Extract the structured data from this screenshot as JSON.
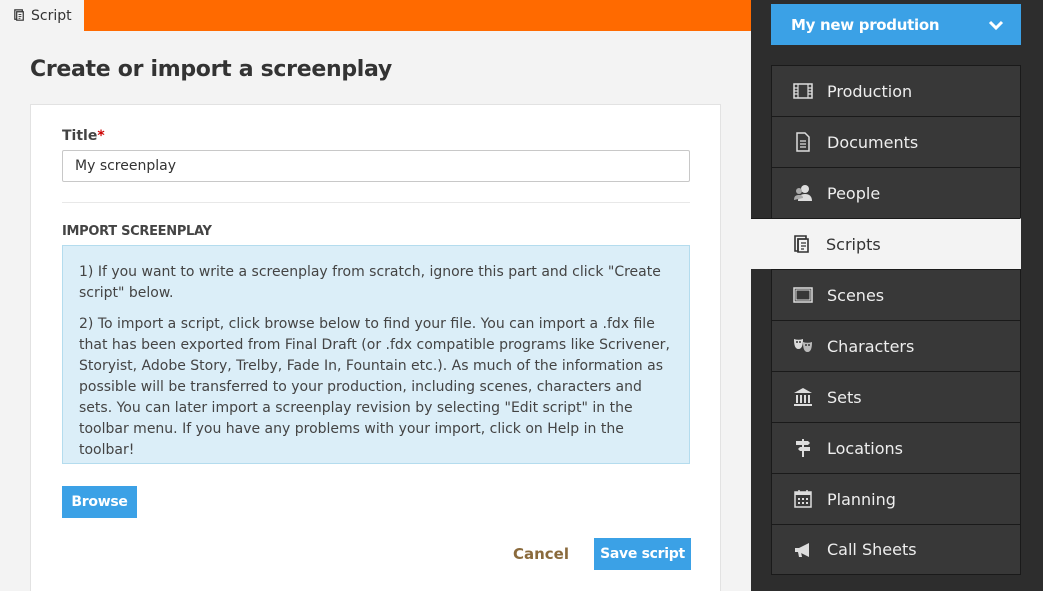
{
  "tab": {
    "label": "Script",
    "icon": "script-icon"
  },
  "page": {
    "title": "Create or import a screenplay"
  },
  "form": {
    "title_label": "Title",
    "required_mark": "*",
    "title_value": "My screenplay",
    "import_label": "IMPORT SCREENPLAY",
    "info_paragraphs": [
      "1) If you want to write a screenplay from scratch, ignore this part and click \"Create script\" below.",
      "2) To import a script, click browse below to find your file. You can import a .fdx file that has been exported from Final Draft (or .fdx compatible programs like Scrivener, Storyist, Adobe Story, Trelby, Fade In, Fountain etc.). As much of the information as possible will be transferred to your production, including scenes, characters and sets. You can later import a screenplay revision by selecting \"Edit script\" in the toolbar menu. If you have any problems with your import, click on Help in the toolbar!"
    ],
    "browse_label": "Browse",
    "cancel_label": "Cancel",
    "save_label": "Save script"
  },
  "sidebar": {
    "production_name": "My new prodution",
    "items": [
      {
        "label": "Production",
        "icon": "film-icon",
        "active": false
      },
      {
        "label": "Documents",
        "icon": "document-icon",
        "active": false
      },
      {
        "label": "People",
        "icon": "people-icon",
        "active": false
      },
      {
        "label": "Scripts",
        "icon": "script-icon",
        "active": true
      },
      {
        "label": "Scenes",
        "icon": "scene-icon",
        "active": false
      },
      {
        "label": "Characters",
        "icon": "masks-icon",
        "active": false
      },
      {
        "label": "Sets",
        "icon": "building-icon",
        "active": false
      },
      {
        "label": "Locations",
        "icon": "signpost-icon",
        "active": false
      },
      {
        "label": "Planning",
        "icon": "calendar-icon",
        "active": false
      },
      {
        "label": "Call Sheets",
        "icon": "megaphone-icon",
        "active": false
      }
    ]
  },
  "colors": {
    "accent": "#3ba1e6",
    "topbar": "#ff6a00",
    "sidebar": "#2d2d2d",
    "info_bg": "#dbeef8"
  }
}
